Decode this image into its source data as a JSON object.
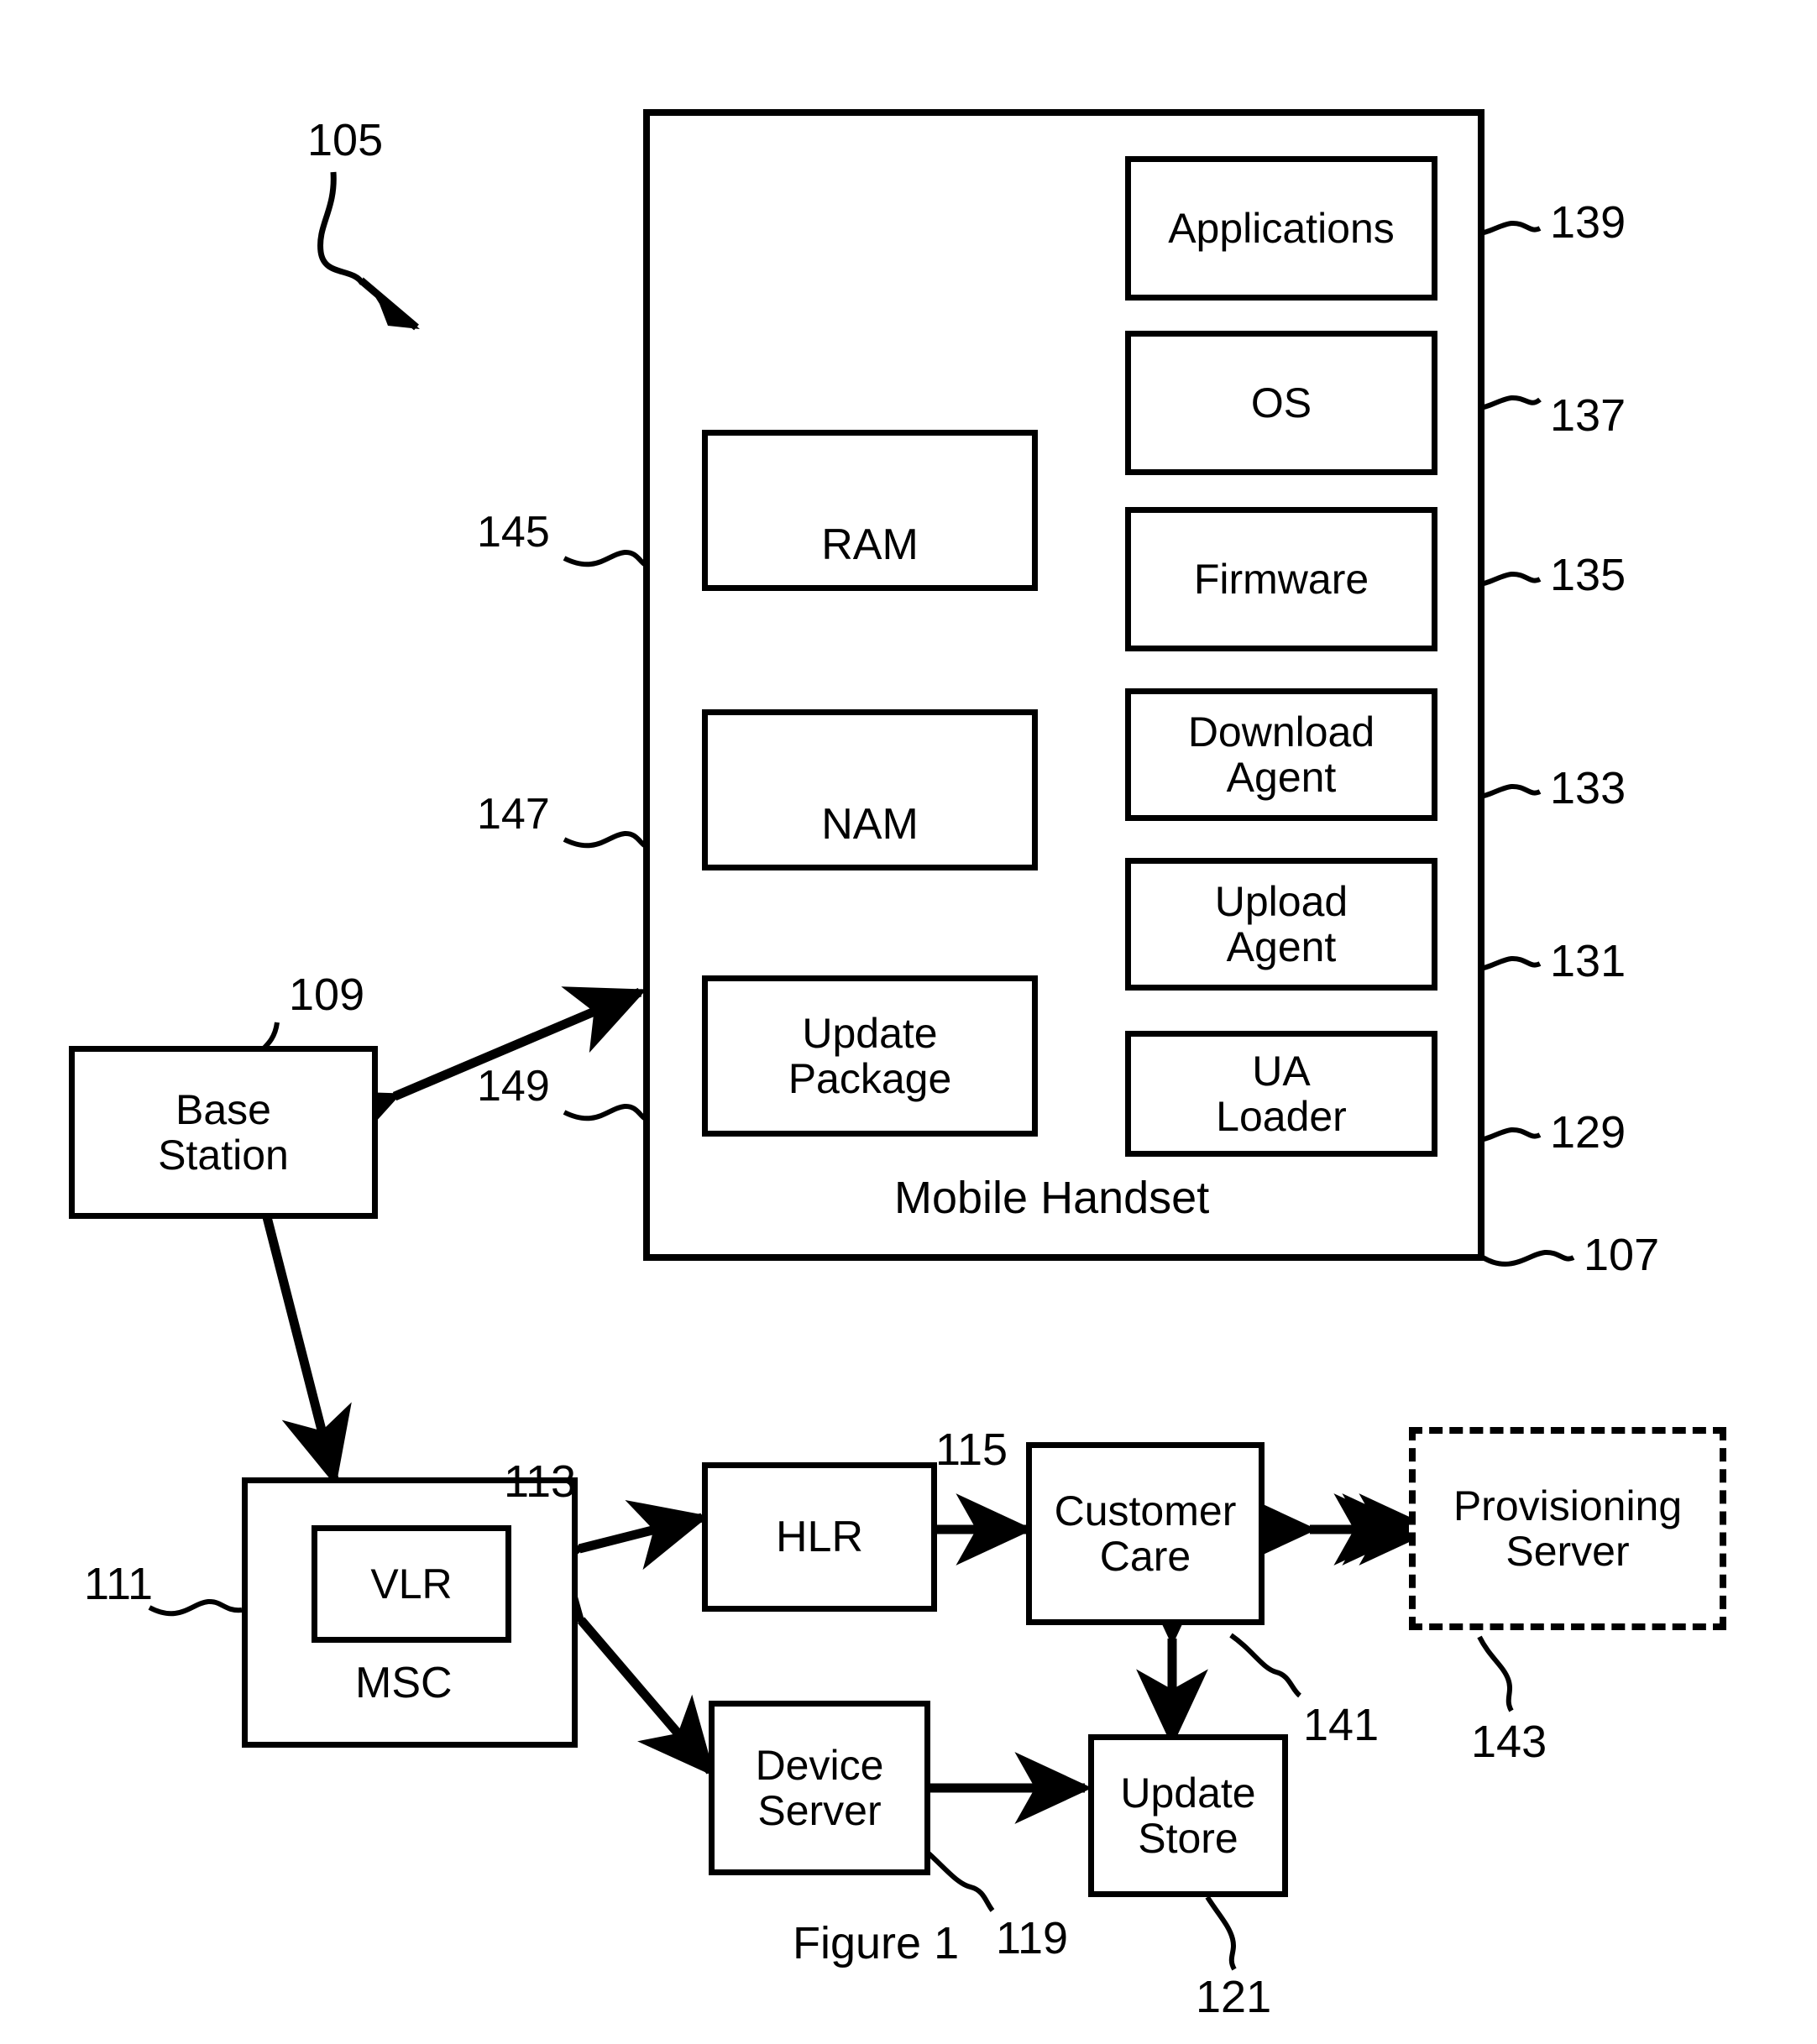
{
  "figure": {
    "caption": "Figure 1",
    "system_ref": "105"
  },
  "handset": {
    "caption": "Mobile Handset",
    "ref": "107",
    "memory_blocks": [
      {
        "label": "RAM",
        "ref": "145"
      },
      {
        "label": "NAM",
        "ref": "147"
      },
      {
        "label": "Update\nPackage",
        "ref": "149"
      }
    ],
    "software_blocks": [
      {
        "label": "Applications",
        "ref": "139"
      },
      {
        "label": "OS",
        "ref": "137"
      },
      {
        "label": "Firmware",
        "ref": "135"
      },
      {
        "label": "Download\nAgent",
        "ref": "133"
      },
      {
        "label": "Upload\nAgent",
        "ref": "131"
      },
      {
        "label": "UA\nLoader",
        "ref": "129"
      }
    ]
  },
  "network": {
    "base_station": {
      "label": "Base\nStation",
      "ref": "109"
    },
    "msc": {
      "label": "MSC",
      "ref": "111"
    },
    "vlr": {
      "label": "VLR",
      "ref": "113"
    },
    "hlr": {
      "label": "HLR",
      "ref": "115"
    },
    "customer_care": {
      "label": "Customer\nCare",
      "ref": "141"
    },
    "provisioning_server": {
      "label": "Provisioning\nServer",
      "ref": "143"
    },
    "device_server": {
      "label": "Device\nServer",
      "ref": "119"
    },
    "update_store": {
      "label": "Update\nStore",
      "ref": "121"
    }
  },
  "colors": {
    "ink": "#000000",
    "paper": "#ffffff"
  }
}
